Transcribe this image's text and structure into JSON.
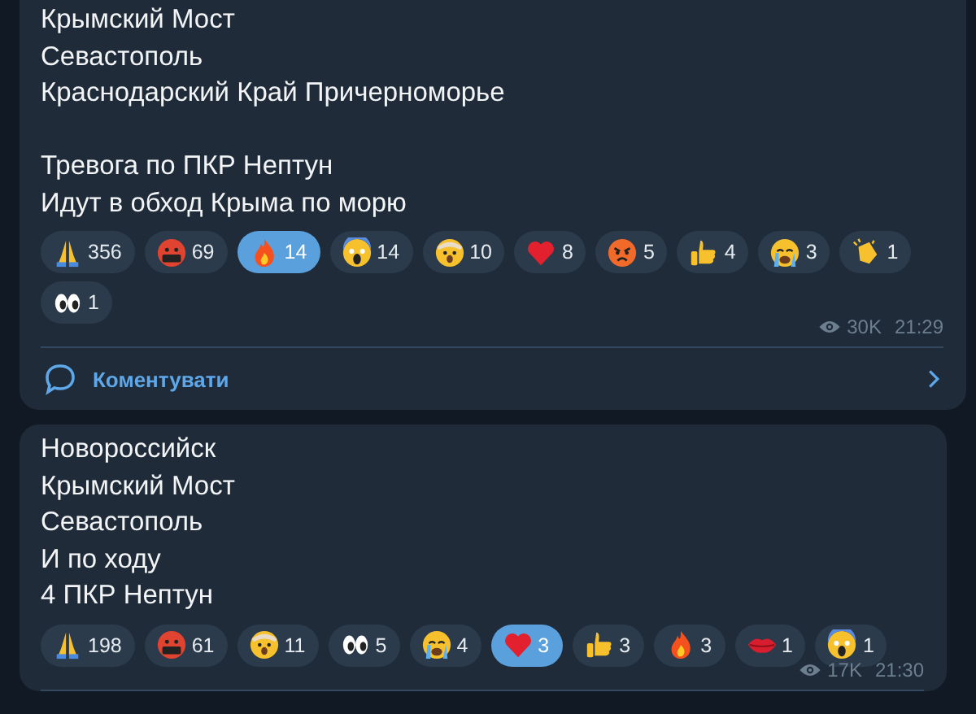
{
  "messages": [
    {
      "paragraphs": [
        [
          "Крымский Мост",
          "Севастополь",
          "Краснодарский Край Причерноморье"
        ],
        [
          "Тревога по ПКР Нептун",
          "Идут в обход Крыма по морю"
        ]
      ],
      "reactions": [
        {
          "kind": "pray",
          "count": "356",
          "selected": false
        },
        {
          "kind": "cursing",
          "count": "69",
          "selected": false
        },
        {
          "kind": "fire",
          "count": "14",
          "selected": true
        },
        {
          "kind": "scream",
          "count": "14",
          "selected": false
        },
        {
          "kind": "exploding",
          "count": "10",
          "selected": false
        },
        {
          "kind": "heart",
          "count": "8",
          "selected": false
        },
        {
          "kind": "angry",
          "count": "5",
          "selected": false
        },
        {
          "kind": "thumbs",
          "count": "4",
          "selected": false
        },
        {
          "kind": "crying",
          "count": "3",
          "selected": false
        },
        {
          "kind": "clap",
          "count": "1",
          "selected": false
        },
        {
          "kind": "eyes",
          "count": "1",
          "selected": false
        }
      ],
      "views": "30K",
      "time": "21:29",
      "comment_label": "Коментувати"
    },
    {
      "paragraphs": [
        [
          "Новороссийск",
          "Крымский Мост",
          "Севастополь",
          "И по ходу",
          "4 ПКР Нептун"
        ]
      ],
      "reactions": [
        {
          "kind": "pray",
          "count": "198",
          "selected": false
        },
        {
          "kind": "cursing",
          "count": "61",
          "selected": false
        },
        {
          "kind": "exploding",
          "count": "11",
          "selected": false
        },
        {
          "kind": "eyes",
          "count": "5",
          "selected": false
        },
        {
          "kind": "crying",
          "count": "4",
          "selected": false
        },
        {
          "kind": "heart",
          "count": "3",
          "selected": true
        },
        {
          "kind": "thumbs",
          "count": "3",
          "selected": false
        },
        {
          "kind": "fire",
          "count": "3",
          "selected": false
        },
        {
          "kind": "kiss",
          "count": "1",
          "selected": false
        },
        {
          "kind": "scream",
          "count": "1",
          "selected": false
        }
      ],
      "views": "17K",
      "time": "21:30"
    }
  ]
}
